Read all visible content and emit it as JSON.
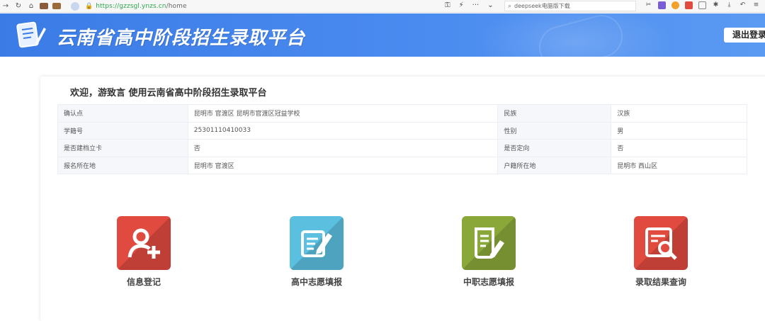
{
  "browser": {
    "url_host": "https://gzzsgl.ynzs.cn",
    "url_path": "/home",
    "search_text": "deepseek电脑版下载"
  },
  "header": {
    "title": "云南省高中阶段招生录取平台",
    "logout_label": "退出登录",
    "colors": {
      "banner": "#3b7be6"
    }
  },
  "main": {
    "welcome": "欢迎，游致言 使用云南省高中阶段招生录取平台",
    "info_rows": [
      [
        "确认点",
        "昆明市 官渡区 昆明市官渡区冠益学校",
        "民族",
        "汉族"
      ],
      [
        "学籍号",
        "25301110410033",
        "性别",
        "男"
      ],
      [
        "是否建档立卡",
        "否",
        "是否定向",
        "否"
      ],
      [
        "报名所在地",
        "昆明市 官渡区",
        "户籍所在地",
        "昆明市 西山区"
      ]
    ],
    "tiles": [
      {
        "label": "信息登记",
        "icon": "user-add-icon",
        "color": "#e04a3f"
      },
      {
        "label": "高中志愿填报",
        "icon": "edit-form-icon",
        "color": "#5bbfe0"
      },
      {
        "label": "中职志愿填报",
        "icon": "document-pen-icon",
        "color": "#8aa83a"
      },
      {
        "label": "录取结果查询",
        "icon": "search-document-icon",
        "color": "#e04a3f"
      }
    ]
  }
}
